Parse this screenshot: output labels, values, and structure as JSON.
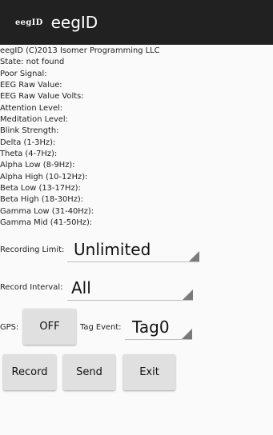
{
  "app": {
    "logo_text": "eegID",
    "title": "eegID"
  },
  "info_lines": [
    "eegID (C)2013 Isomer Programming LLC",
    "State: not found",
    "Poor Signal:",
    "EEG Raw Value:",
    "EEG Raw Value Volts:",
    "Attention Level:",
    "Meditation Level:",
    "Blink Strength:",
    "Delta (1-3Hz):",
    "Theta (4-7Hz):",
    "Alpha Low (8-9Hz):",
    "Alpha High (10-12Hz):",
    "Beta Low (13-17Hz):",
    "Beta High (18-30Hz):",
    "Gamma Low (31-40Hz):",
    "Gamma Mid (41-50Hz):"
  ],
  "controls": {
    "recording_limit": {
      "label": "Recording Limit:",
      "value": "Unlimited"
    },
    "record_interval": {
      "label": "Record Interval:",
      "value": "All"
    },
    "gps": {
      "label": "GPS:",
      "button": "OFF"
    },
    "tag_event": {
      "label": "Tag Event:",
      "value": "Tag0"
    }
  },
  "actions": {
    "record": "Record",
    "send": "Send",
    "exit": "Exit"
  },
  "colors": {
    "appbar": "#212121",
    "background": "#fafafa",
    "button": "#e0e0e0"
  },
  "icons": {
    "dropdown": "dropdown-triangle-icon"
  }
}
